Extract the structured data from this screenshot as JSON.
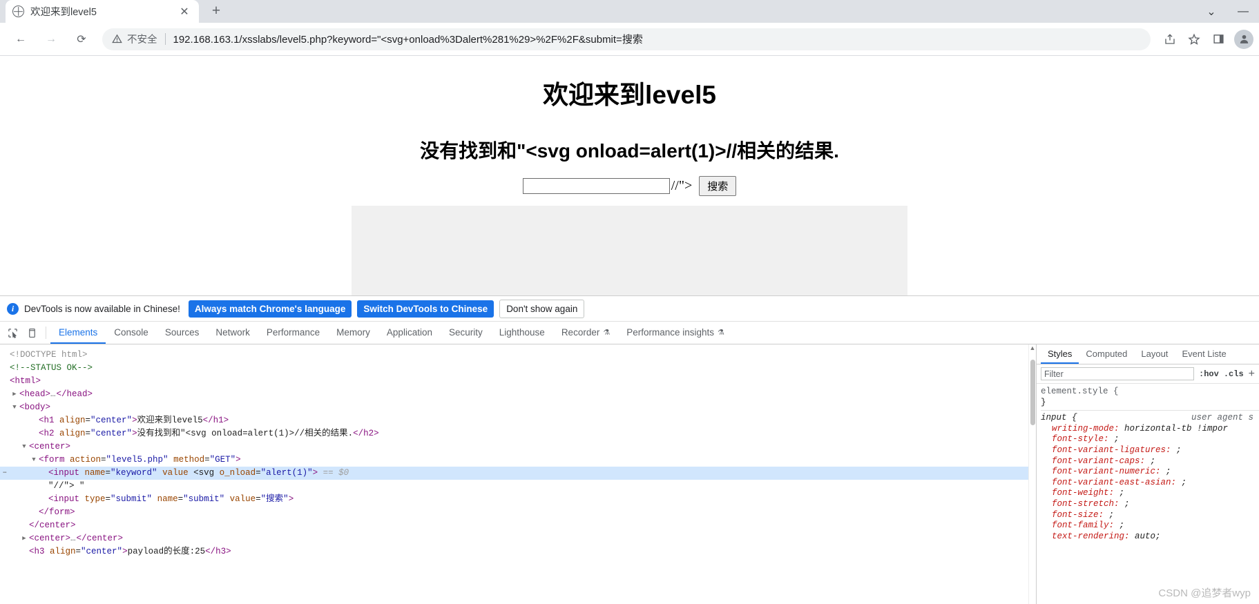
{
  "browser": {
    "tab": {
      "title": "欢迎来到level5",
      "favicon": "globe-icon",
      "close": "✕"
    },
    "new_tab": "+",
    "window_controls": {
      "list": "⌄",
      "minimize": "—"
    },
    "nav": {
      "back": "←",
      "forward": "→",
      "reload": "⟳"
    },
    "omnibox": {
      "security_label": "不安全",
      "url": "192.168.163.1/xsslabs/level5.php?keyword=\"<svg+onload%3Dalert%281%29>%2F%2F&submit=搜索"
    },
    "toolbar_icons": {
      "share": "share-icon",
      "bookmark": "star-icon",
      "sidepanel": "side-panel-icon",
      "profile": "avatar-icon"
    }
  },
  "page": {
    "h1": "欢迎来到level5",
    "h2": "没有找到和\"<svg onload=alert(1)>//相关的结果.",
    "input_value": "",
    "after_input_text": "//\">",
    "submit_label": "搜索"
  },
  "notice": {
    "icon": "info-icon",
    "text": "DevTools is now available in Chinese!",
    "buttons": [
      {
        "label": "Always match Chrome's language",
        "style": "primary"
      },
      {
        "label": "Switch DevTools to Chinese",
        "style": "primary"
      },
      {
        "label": "Don't show again",
        "style": "plain"
      }
    ]
  },
  "devtools": {
    "tools": [
      "inspect-icon",
      "device-toolbar-icon"
    ],
    "tabs": [
      {
        "label": "Elements",
        "active": true
      },
      {
        "label": "Console",
        "active": false
      },
      {
        "label": "Sources",
        "active": false
      },
      {
        "label": "Network",
        "active": false
      },
      {
        "label": "Performance",
        "active": false
      },
      {
        "label": "Memory",
        "active": false
      },
      {
        "label": "Application",
        "active": false
      },
      {
        "label": "Security",
        "active": false
      },
      {
        "label": "Lighthouse",
        "active": false
      },
      {
        "label": "Recorder",
        "active": false,
        "badge": "experiment-icon"
      },
      {
        "label": "Performance insights",
        "active": false,
        "badge": "experiment-icon"
      }
    ],
    "dom": [
      {
        "id": "l1",
        "indent": 0,
        "twisty": "",
        "selected": false,
        "parts": [
          {
            "c": "dt",
            "t": "<!DOCTYPE html>"
          }
        ]
      },
      {
        "id": "l2",
        "indent": 0,
        "twisty": "",
        "selected": false,
        "parts": [
          {
            "c": "cm",
            "t": "<!--STATUS OK-->"
          }
        ]
      },
      {
        "id": "l3",
        "indent": 0,
        "twisty": "",
        "selected": false,
        "parts": [
          {
            "c": "tg",
            "t": "<html>"
          }
        ]
      },
      {
        "id": "l4",
        "indent": 1,
        "twisty": "▶",
        "selected": false,
        "parts": [
          {
            "c": "tg",
            "t": "<head>"
          },
          {
            "c": "ell",
            "t": "…"
          },
          {
            "c": "tg",
            "t": "</head>"
          }
        ]
      },
      {
        "id": "l5",
        "indent": 1,
        "twisty": "▼",
        "selected": false,
        "parts": [
          {
            "c": "tg",
            "t": "<body>"
          }
        ]
      },
      {
        "id": "l6",
        "indent": 3,
        "twisty": "",
        "selected": false,
        "parts": [
          {
            "c": "tg",
            "t": "<h1 "
          },
          {
            "c": "at",
            "t": "align"
          },
          {
            "c": "tx",
            "t": "="
          },
          {
            "c": "av",
            "t": "\"center\""
          },
          {
            "c": "tg",
            "t": ">"
          },
          {
            "c": "tx",
            "t": "欢迎来到level5"
          },
          {
            "c": "tg",
            "t": "</h1>"
          }
        ]
      },
      {
        "id": "l7",
        "indent": 3,
        "twisty": "",
        "selected": false,
        "parts": [
          {
            "c": "tg",
            "t": "<h2 "
          },
          {
            "c": "at",
            "t": "align"
          },
          {
            "c": "tx",
            "t": "="
          },
          {
            "c": "av",
            "t": "\"center\""
          },
          {
            "c": "tg",
            "t": ">"
          },
          {
            "c": "tx",
            "t": "没有找到和\"<svg onload=alert(1)>//相关的结果."
          },
          {
            "c": "tg",
            "t": "</h2>"
          }
        ]
      },
      {
        "id": "l8",
        "indent": 2,
        "twisty": "▼",
        "selected": false,
        "parts": [
          {
            "c": "tg",
            "t": "<center>"
          }
        ]
      },
      {
        "id": "l9",
        "indent": 3,
        "twisty": "▼",
        "selected": false,
        "parts": [
          {
            "c": "tg",
            "t": "<form "
          },
          {
            "c": "at",
            "t": "action"
          },
          {
            "c": "tx",
            "t": "="
          },
          {
            "c": "av",
            "t": "\"level5.php\""
          },
          {
            "c": "tx",
            "t": " "
          },
          {
            "c": "at",
            "t": "method"
          },
          {
            "c": "tx",
            "t": "="
          },
          {
            "c": "av",
            "t": "\"GET\""
          },
          {
            "c": "tg",
            "t": ">"
          }
        ]
      },
      {
        "id": "l10",
        "indent": 4,
        "twisty": "⋯",
        "selected": true,
        "parts": [
          {
            "c": "tg",
            "t": "<input "
          },
          {
            "c": "at",
            "t": "name"
          },
          {
            "c": "tx",
            "t": "="
          },
          {
            "c": "av",
            "t": "\"keyword\""
          },
          {
            "c": "tx",
            "t": " "
          },
          {
            "c": "at",
            "t": "value"
          },
          {
            "c": "tx",
            "t": " <svg "
          },
          {
            "c": "at",
            "t": "o_nload"
          },
          {
            "c": "tx",
            "t": "="
          },
          {
            "c": "av",
            "t": "\"alert(1)\""
          },
          {
            "c": "tg",
            "t": ">"
          },
          {
            "c": "eq",
            "t": " == $0"
          }
        ]
      },
      {
        "id": "l11",
        "indent": 4,
        "twisty": "",
        "selected": false,
        "parts": [
          {
            "c": "tx",
            "t": "\"//\"> \""
          }
        ]
      },
      {
        "id": "l12",
        "indent": 4,
        "twisty": "",
        "selected": false,
        "parts": [
          {
            "c": "tg",
            "t": "<input "
          },
          {
            "c": "at",
            "t": "type"
          },
          {
            "c": "tx",
            "t": "="
          },
          {
            "c": "av",
            "t": "\"submit\""
          },
          {
            "c": "tx",
            "t": " "
          },
          {
            "c": "at",
            "t": "name"
          },
          {
            "c": "tx",
            "t": "="
          },
          {
            "c": "av",
            "t": "\"submit\""
          },
          {
            "c": "tx",
            "t": " "
          },
          {
            "c": "at",
            "t": "value"
          },
          {
            "c": "tx",
            "t": "="
          },
          {
            "c": "av",
            "t": "\"搜索\""
          },
          {
            "c": "tg",
            "t": ">"
          }
        ]
      },
      {
        "id": "l13",
        "indent": 3,
        "twisty": "",
        "selected": false,
        "parts": [
          {
            "c": "tg",
            "t": "</form>"
          }
        ]
      },
      {
        "id": "l14",
        "indent": 2,
        "twisty": "",
        "selected": false,
        "parts": [
          {
            "c": "tg",
            "t": "</center>"
          }
        ]
      },
      {
        "id": "l15",
        "indent": 2,
        "twisty": "▶",
        "selected": false,
        "parts": [
          {
            "c": "tg",
            "t": "<center>"
          },
          {
            "c": "ell",
            "t": "…"
          },
          {
            "c": "tg",
            "t": "</center>"
          }
        ]
      },
      {
        "id": "l16",
        "indent": 2,
        "twisty": "",
        "selected": false,
        "parts": [
          {
            "c": "tg",
            "t": "<h3 "
          },
          {
            "c": "at",
            "t": "align"
          },
          {
            "c": "tx",
            "t": "="
          },
          {
            "c": "av",
            "t": "\"center\""
          },
          {
            "c": "tg",
            "t": ">"
          },
          {
            "c": "tx",
            "t": "payload的长度:25"
          },
          {
            "c": "tg",
            "t": "</h3>"
          }
        ]
      }
    ],
    "styles": {
      "tabs": [
        {
          "label": "Styles",
          "active": true
        },
        {
          "label": "Computed",
          "active": false
        },
        {
          "label": "Layout",
          "active": false
        },
        {
          "label": "Event Liste",
          "active": false
        }
      ],
      "filter_placeholder": "Filter",
      "hov": ":hov",
      "cls": ".cls",
      "plus": "+",
      "rules": [
        {
          "selector": "element.style",
          "source": "",
          "open": "{",
          "close": "}",
          "props": []
        },
        {
          "selector": "input",
          "source": "user agent s",
          "open": "{",
          "close": "",
          "props": [
            {
              "name": "writing-mode",
              "value": "horizontal-tb !impor"
            },
            {
              "name": "font-style",
              "value": ";"
            },
            {
              "name": "font-variant-ligatures",
              "value": ";"
            },
            {
              "name": "font-variant-caps",
              "value": ";"
            },
            {
              "name": "font-variant-numeric",
              "value": ";"
            },
            {
              "name": "font-variant-east-asian",
              "value": ";"
            },
            {
              "name": "font-weight",
              "value": ";"
            },
            {
              "name": "font-stretch",
              "value": ";"
            },
            {
              "name": "font-size",
              "value": ";"
            },
            {
              "name": "font-family",
              "value": ";"
            },
            {
              "name": "text-rendering",
              "value": "auto;"
            }
          ]
        }
      ]
    }
  },
  "watermark": "CSDN @追梦者wyp",
  "colors": {
    "accent": "#1a73e8",
    "chrome_bg": "#dee1e6",
    "page_box": "#f0f0f0"
  }
}
